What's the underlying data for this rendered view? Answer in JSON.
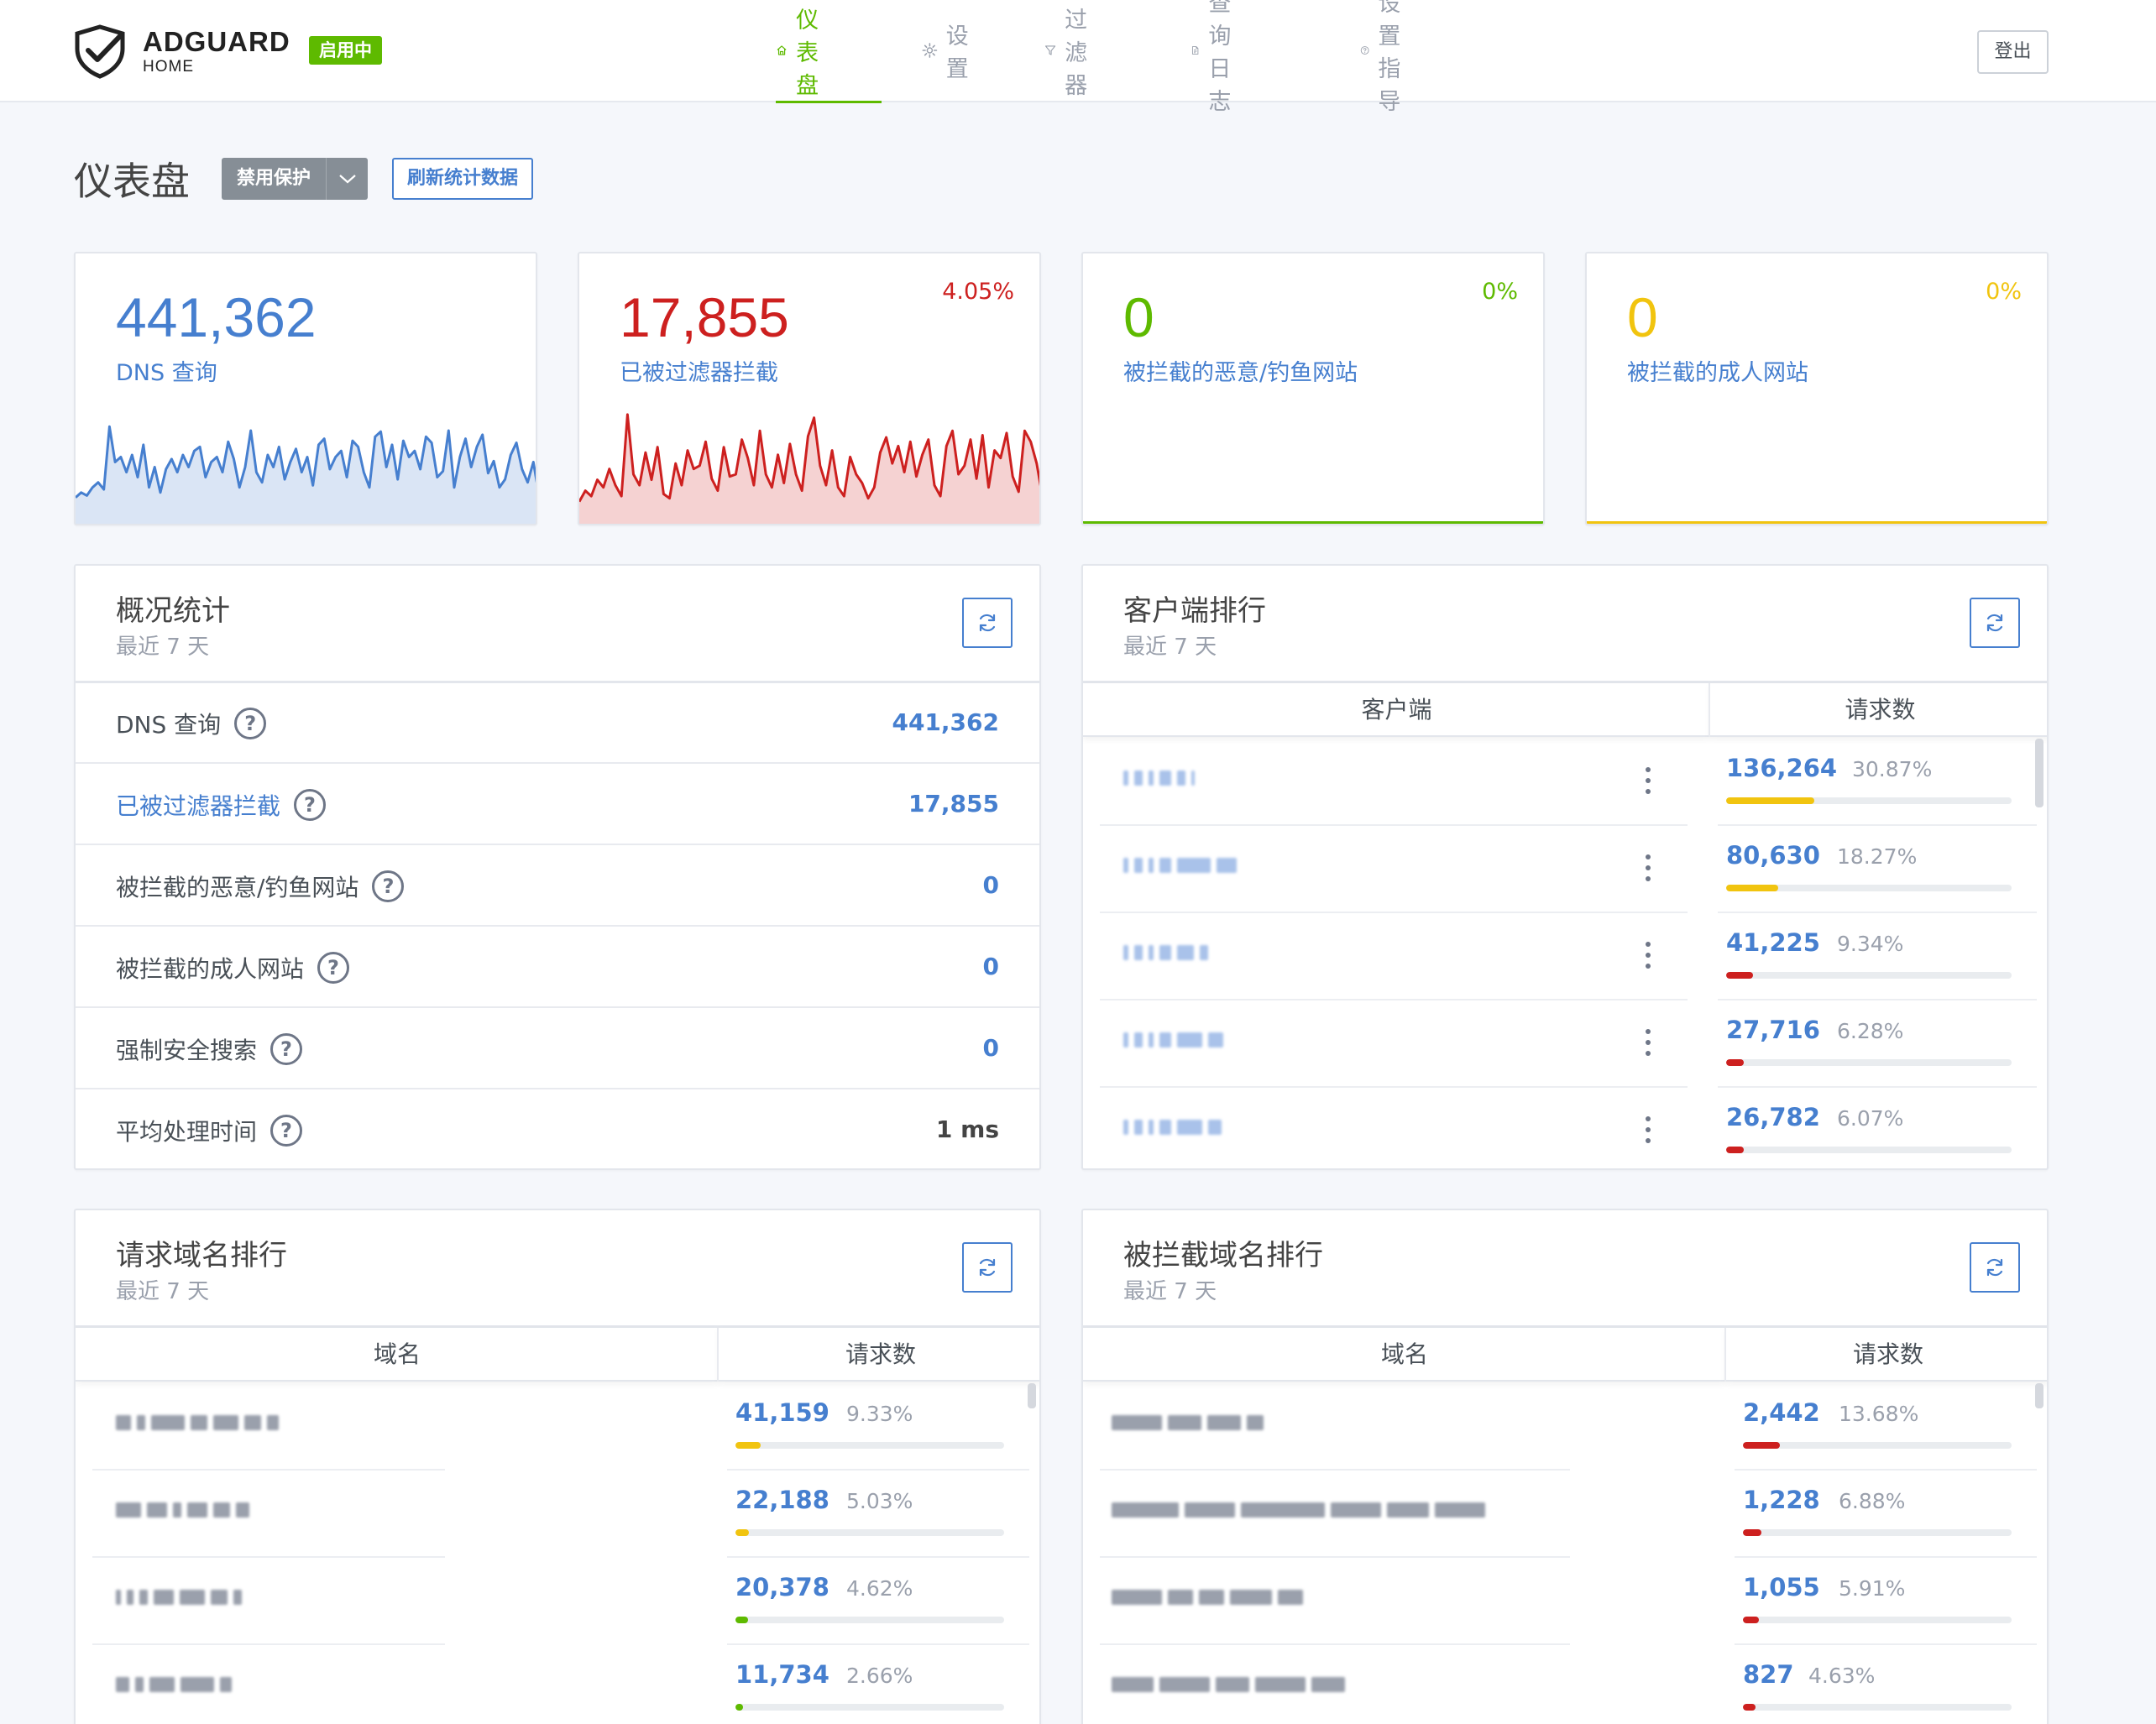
{
  "header": {
    "brand": "ADGUARD",
    "brand_sub": "HOME",
    "status_badge": "启用中",
    "nav": [
      {
        "label": "仪表盘",
        "icon": "home-icon",
        "active": true
      },
      {
        "label": "设置",
        "icon": "gear-icon",
        "active": false
      },
      {
        "label": "过滤器",
        "icon": "filter-icon",
        "active": false
      },
      {
        "label": "查询日志",
        "icon": "document-icon",
        "active": false
      },
      {
        "label": "设置指导",
        "icon": "help-circle-icon",
        "active": false
      }
    ],
    "logout": "登出"
  },
  "toolbar": {
    "page_title": "仪表盘",
    "disable_protection": "禁用保护",
    "refresh_stats": "刷新统计数据"
  },
  "colors": {
    "blue": "#467fcf",
    "red": "#cd201f",
    "green": "#5eba00",
    "yellow": "#f1c40f"
  },
  "stat_cards": [
    {
      "value": "441,362",
      "label": "DNS 查询",
      "percent": "",
      "color": "#467fcf"
    },
    {
      "value": "17,855",
      "label": "已被过滤器拦截",
      "percent": "4.05%",
      "color": "#cd201f"
    },
    {
      "value": "0",
      "label": "被拦截的恶意/钓鱼网站",
      "percent": "0%",
      "color": "#5eba00"
    },
    {
      "value": "0",
      "label": "被拦截的成人网站",
      "percent": "0%",
      "color": "#f1c40f"
    }
  ],
  "chart_data": [
    {
      "type": "area",
      "values": [
        20,
        25,
        22,
        30,
        35,
        28,
        90,
        55,
        60,
        45,
        62,
        40,
        72,
        30,
        50,
        25,
        48,
        58,
        45,
        62,
        50,
        66,
        70,
        40,
        55,
        60,
        45,
        75,
        58,
        30,
        50,
        86,
        45,
        35,
        62,
        50,
        70,
        38,
        55,
        68,
        45,
        60,
        32,
        72,
        78,
        48,
        60,
        66,
        40,
        76,
        70,
        45,
        30,
        80,
        85,
        50,
        72,
        38,
        76,
        60,
        66,
        48,
        80,
        74,
        40,
        46,
        86,
        30,
        60,
        78,
        50,
        70,
        82,
        44,
        56,
        30,
        38,
        62,
        74,
        48,
        35,
        55,
        22
      ],
      "ylim": [
        0,
        110
      ]
    },
    {
      "type": "area",
      "values": [
        15,
        25,
        20,
        35,
        28,
        45,
        30,
        20,
        95,
        40,
        30,
        60,
        35,
        65,
        22,
        18,
        50,
        30,
        62,
        45,
        48,
        70,
        36,
        25,
        65,
        38,
        40,
        72,
        55,
        30,
        80,
        40,
        28,
        58,
        32,
        68,
        40,
        25,
        75,
        92,
        48,
        30,
        62,
        28,
        20,
        56,
        40,
        32,
        18,
        28,
        60,
        74,
        50,
        66,
        42,
        70,
        38,
        58,
        72,
        30,
        20,
        66,
        80,
        40,
        48,
        72,
        36,
        76,
        28,
        62,
        55,
        78,
        38,
        24,
        80,
        70,
        50,
        18
      ]
    }
  ],
  "overview": {
    "title": "概况统计",
    "subtitle": "最近 7 天",
    "rows": [
      {
        "label": "DNS 查询",
        "value": "441,362",
        "blue_label": false,
        "dark_value": false
      },
      {
        "label": "已被过滤器拦截",
        "value": "17,855",
        "blue_label": true,
        "dark_value": false
      },
      {
        "label": "被拦截的恶意/钓鱼网站",
        "value": "0",
        "blue_label": false,
        "dark_value": false
      },
      {
        "label": "被拦截的成人网站",
        "value": "0",
        "blue_label": false,
        "dark_value": false
      },
      {
        "label": "强制安全搜索",
        "value": "0",
        "blue_label": false,
        "dark_value": false
      },
      {
        "label": "平均处理时间",
        "value": "1 ms",
        "blue_label": false,
        "dark_value": true
      }
    ]
  },
  "clients": {
    "title": "客户端排行",
    "subtitle": "最近 7 天",
    "col_client": "客户端",
    "col_requests": "请求数",
    "rows": [
      {
        "count": "136,264",
        "percent": "30.87%",
        "fill": 0.3087,
        "color": "#f1c40f"
      },
      {
        "count": "80,630",
        "percent": "18.27%",
        "fill": 0.1827,
        "color": "#f1c40f"
      },
      {
        "count": "41,225",
        "percent": "9.34%",
        "fill": 0.0934,
        "color": "#cd201f"
      },
      {
        "count": "27,716",
        "percent": "6.28%",
        "fill": 0.0628,
        "color": "#cd201f"
      },
      {
        "count": "26,782",
        "percent": "6.07%",
        "fill": 0.0607,
        "color": "#cd201f"
      }
    ]
  },
  "top_domains": {
    "title": "请求域名排行",
    "subtitle": "最近 7 天",
    "col_domain": "域名",
    "col_requests": "请求数",
    "rows": [
      {
        "count": "41,159",
        "percent": "9.33%",
        "fill": 0.0933,
        "color": "#f1c40f"
      },
      {
        "count": "22,188",
        "percent": "5.03%",
        "fill": 0.0503,
        "color": "#f1c40f"
      },
      {
        "count": "20,378",
        "percent": "4.62%",
        "fill": 0.0462,
        "color": "#5eba00"
      },
      {
        "count": "11,734",
        "percent": "2.66%",
        "fill": 0.0266,
        "color": "#5eba00"
      }
    ]
  },
  "blocked_domains": {
    "title": "被拦截域名排行",
    "subtitle": "最近 7 天",
    "col_domain": "域名",
    "col_requests": "请求数",
    "rows": [
      {
        "count": "2,442",
        "percent": "13.68%",
        "fill": 0.1368,
        "color": "#cd201f"
      },
      {
        "count": "1,228",
        "percent": "6.88%",
        "fill": 0.0688,
        "color": "#cd201f"
      },
      {
        "count": "1,055",
        "percent": "5.91%",
        "fill": 0.0591,
        "color": "#cd201f"
      },
      {
        "count": "827",
        "percent": "4.63%",
        "fill": 0.0463,
        "color": "#cd201f"
      }
    ]
  }
}
